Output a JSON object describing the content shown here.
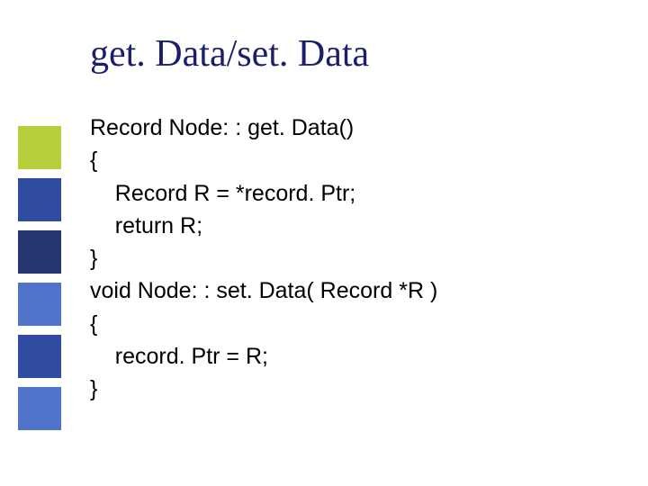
{
  "slide": {
    "title": "get. Data/set. Data",
    "code_lines": [
      "Record Node: : get. Data()",
      "{",
      "    Record R = *record. Ptr;",
      "    return R;",
      "}",
      "void Node: : set. Data( Record *R )",
      "{",
      "    record. Ptr = R;",
      "}"
    ]
  },
  "sidebar_colors": [
    "#b6cf3a",
    "#2f4aa0",
    "#24356f",
    "#4f74c9",
    "#2f4aa0",
    "#4f74c9"
  ]
}
